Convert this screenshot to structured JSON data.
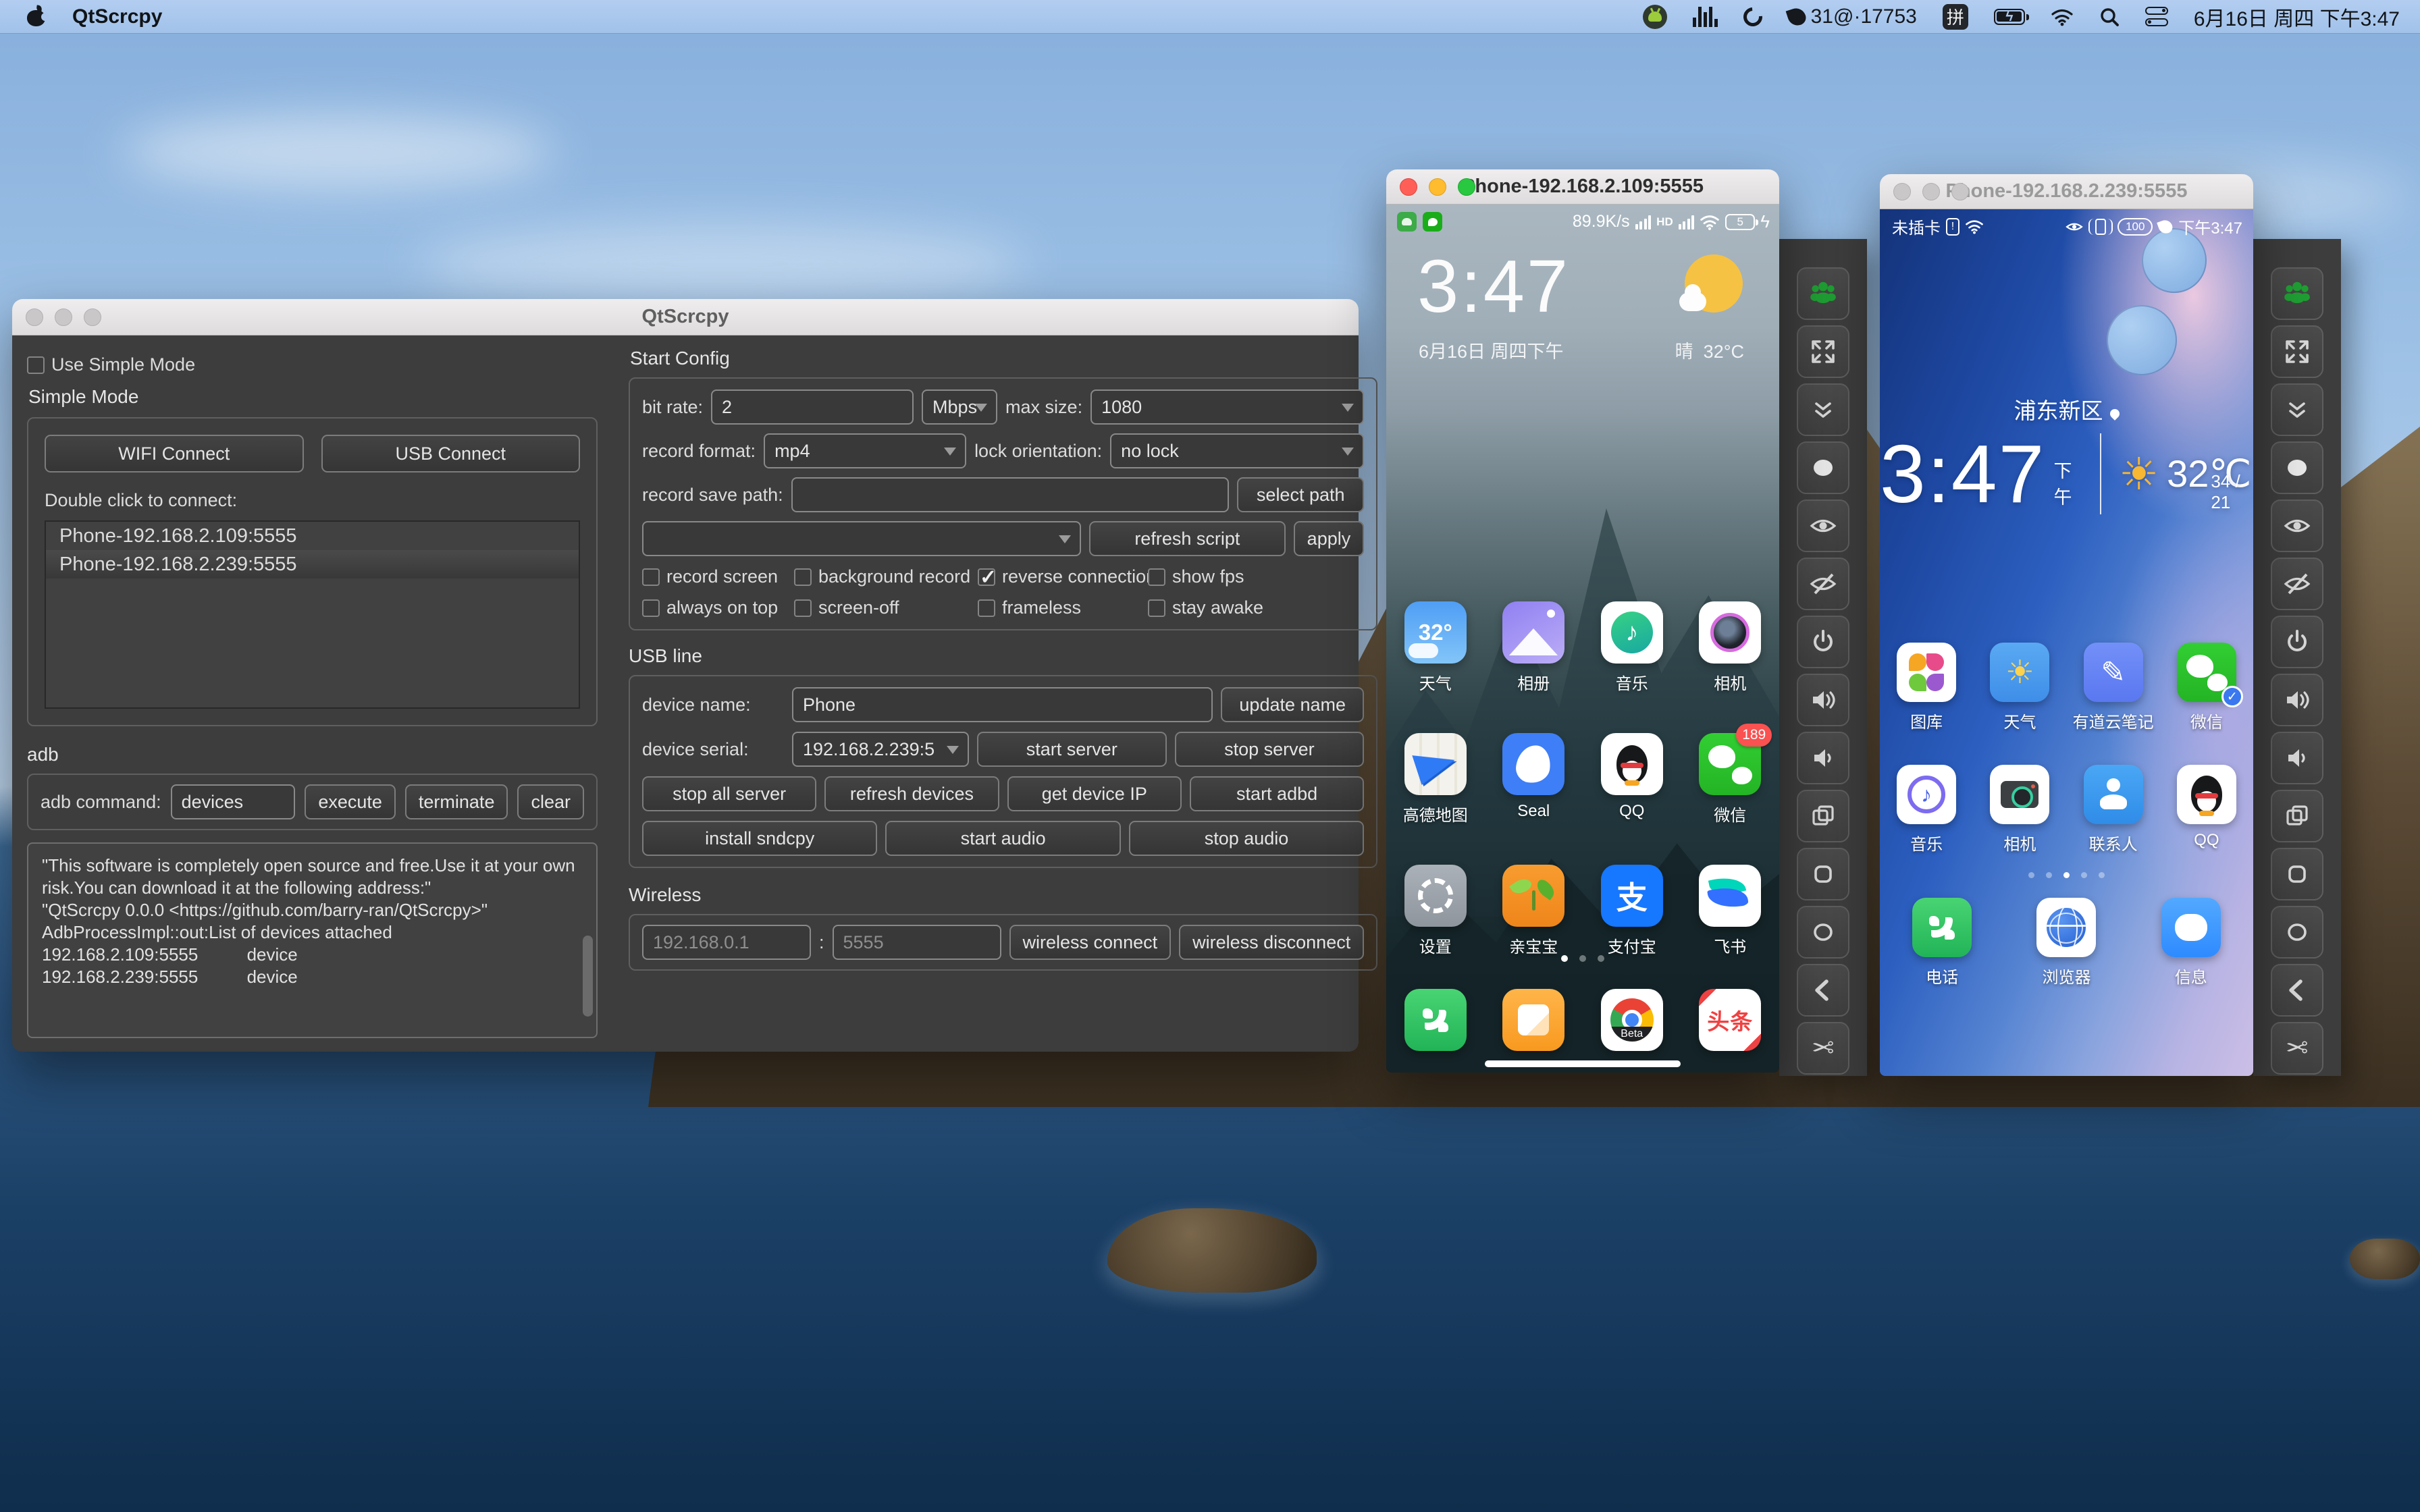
{
  "menubar": {
    "app_name": "QtScrcpy",
    "net_text": "31@·17753",
    "ime": "拼",
    "battery_pct": "",
    "datetime": "6月16日 周四 下午3:47"
  },
  "qtscrcpy": {
    "title": "QtScrcpy",
    "left": {
      "use_simple_mode": "Use Simple Mode",
      "simple_mode": "Simple Mode",
      "wifi_connect": "WIFI Connect",
      "usb_connect": "USB Connect",
      "double_click": "Double click to connect:",
      "devices": [
        {
          "label": "Phone-192.168.2.109:5555"
        },
        {
          "label": "Phone-192.168.2.239:5555"
        }
      ],
      "adb_label": "adb",
      "adb_command_label": "adb command:",
      "adb_command_value": "devices",
      "execute": "execute",
      "terminate": "terminate",
      "clear": "clear",
      "log": [
        "\"This software is completely open source and free.Use it at your own risk.You can download it at the following address:\"",
        "",
        "\"QtScrcpy 0.0.0 <https://github.com/barry-ran/QtScrcpy>\"",
        "",
        "AdbProcessImpl::out:List of devices attached",
        "192.168.2.109:5555          device",
        "192.168.2.239:5555          device"
      ]
    },
    "right": {
      "start_config": "Start Config",
      "bit_rate_label": "bit rate:",
      "bit_rate_value": "2",
      "bit_rate_unit": "Mbps",
      "max_size_label": "max size:",
      "max_size_value": "1080",
      "record_format_label": "record format:",
      "record_format_value": "mp4",
      "lock_orientation_label": "lock orientation:",
      "lock_orientation_value": "no lock",
      "record_save_path_label": "record save path:",
      "record_save_path_value": "",
      "select_path": "select path",
      "script_value": "",
      "refresh_script": "refresh script",
      "apply": "apply",
      "checks1": [
        {
          "label": "record screen",
          "checked": false
        },
        {
          "label": "background record",
          "checked": false
        },
        {
          "label": "reverse connection",
          "checked": true
        },
        {
          "label": "show fps",
          "checked": false
        }
      ],
      "checks2": [
        {
          "label": "always on top",
          "checked": false
        },
        {
          "label": "screen-off",
          "checked": false
        },
        {
          "label": "frameless",
          "checked": false
        },
        {
          "label": "stay awake",
          "checked": false
        }
      ],
      "usb_line": "USB line",
      "device_name_label": "device name:",
      "device_name_value": "Phone",
      "update_name": "update name",
      "device_serial_label": "device serial:",
      "device_serial_value": "192.168.2.239:5",
      "start_server": "start server",
      "stop_server": "stop server",
      "stop_all_server": "stop all server",
      "refresh_devices": "refresh devices",
      "get_device_ip": "get device IP",
      "start_adbd": "start adbd",
      "install_sndcpy": "install sndcpy",
      "start_audio": "start audio",
      "stop_audio": "stop audio",
      "wireless": "Wireless",
      "wireless_ip_placeholder": "192.168.0.1",
      "wireless_colon": ":",
      "wireless_port_placeholder": "5555",
      "wireless_connect": "wireless connect",
      "wireless_disconnect": "wireless disconnect"
    }
  },
  "phone1": {
    "title": "Phone-192.168.2.109:5555",
    "status": {
      "speed": "89.9K/s",
      "hd": "HD",
      "battery": "5"
    },
    "clock": "3:47",
    "date": "6月16日 周四下午",
    "weather_cond": "晴",
    "weather_temp": "32°C",
    "grid": [
      {
        "label": "天气",
        "glyph": "32°"
      },
      {
        "label": "相册"
      },
      {
        "label": "音乐"
      },
      {
        "label": "相机"
      },
      {
        "label": "高德地图"
      },
      {
        "label": "Seal"
      },
      {
        "label": "QQ"
      },
      {
        "label": "微信",
        "badge": "189"
      },
      {
        "label": "设置"
      },
      {
        "label": "亲宝宝"
      },
      {
        "label": "支付宝",
        "glyph": "支"
      },
      {
        "label": "飞书"
      }
    ],
    "chrome_beta": "Beta",
    "toutiao": "头条"
  },
  "phone2": {
    "title": "Phone-192.168.2.239:5555",
    "status": {
      "no_sim": "未插卡",
      "battery": "100",
      "time": "下午3:47"
    },
    "location": "浦东新区",
    "clock": "3:47",
    "ampm": "下午",
    "temp": "32℃",
    "hilo": "34 / 21",
    "grid": [
      {
        "label": "图库"
      },
      {
        "label": "天气"
      },
      {
        "label": "有道云笔记"
      },
      {
        "label": "微信"
      },
      {
        "label": "音乐"
      },
      {
        "label": "相机"
      },
      {
        "label": "联系人"
      },
      {
        "label": "QQ"
      }
    ],
    "dock": [
      {
        "label": "电话"
      },
      {
        "label": "浏览器"
      },
      {
        "label": "信息"
      }
    ]
  }
}
